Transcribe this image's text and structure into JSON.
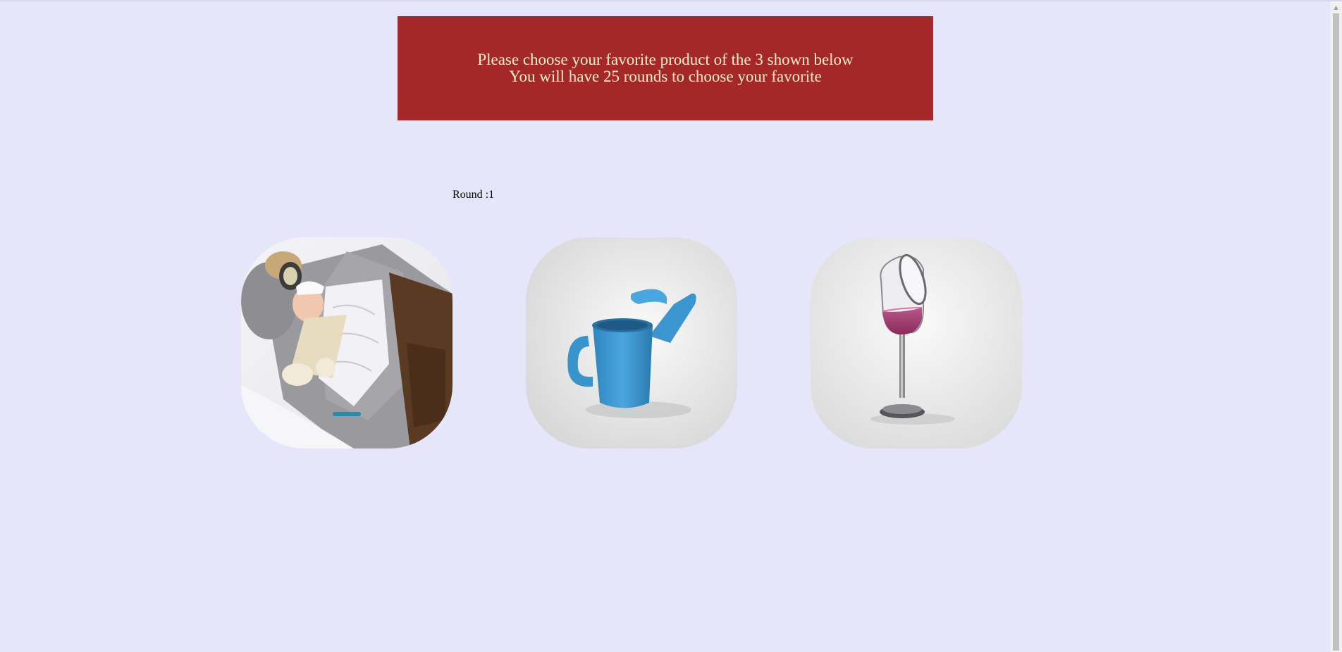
{
  "header": {
    "line1": "Please choose your favorite product of the 3 shown below",
    "line2": "You will have 25 rounds to choose your favorite"
  },
  "round": {
    "label": "Round :1"
  },
  "products": [
    {
      "name": "sleeping-bag-costume"
    },
    {
      "name": "watering-can"
    },
    {
      "name": "wine-glass"
    }
  ],
  "colors": {
    "background": "#e6e6fa",
    "header_bg": "#a42828",
    "header_text": "#fff0c8"
  }
}
